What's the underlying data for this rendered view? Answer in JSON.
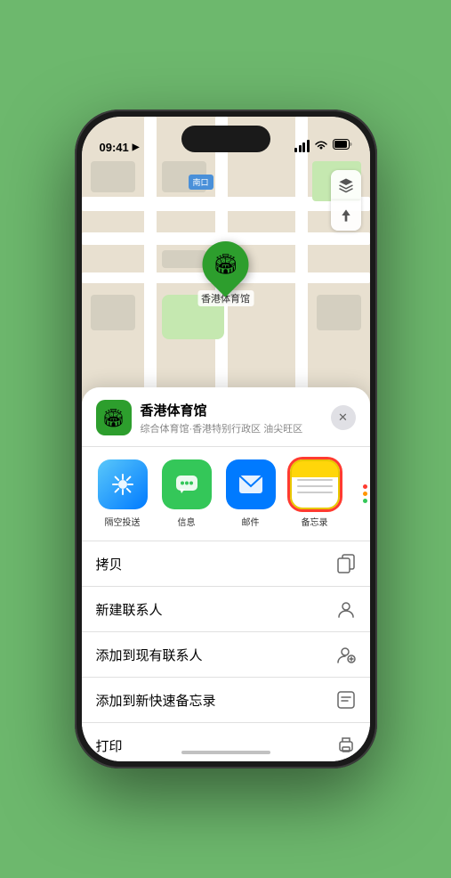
{
  "status": {
    "time": "09:41",
    "location_icon": "▶"
  },
  "map": {
    "label": "南口",
    "layer_icon": "🗺",
    "location_icon": "⤢"
  },
  "pin": {
    "label": "香港体育馆",
    "icon": "🏟"
  },
  "venue": {
    "name": "香港体育馆",
    "subtitle": "综合体育馆·香港特别行政区 油尖旺区",
    "icon": "🏟",
    "close_label": "✕"
  },
  "share_items": [
    {
      "id": "airdrop",
      "label": "隔空投送",
      "icon": "📡",
      "type": "airdrop"
    },
    {
      "id": "messages",
      "label": "信息",
      "icon": "💬",
      "type": "messages"
    },
    {
      "id": "mail",
      "label": "邮件",
      "icon": "✉️",
      "type": "mail"
    },
    {
      "id": "notes",
      "label": "备忘录",
      "icon": "",
      "type": "notes"
    }
  ],
  "actions": [
    {
      "id": "copy",
      "label": "拷贝",
      "icon": "⎘"
    },
    {
      "id": "new-contact",
      "label": "新建联系人",
      "icon": "👤"
    },
    {
      "id": "add-contact",
      "label": "添加到现有联系人",
      "icon": "👤"
    },
    {
      "id": "quick-note",
      "label": "添加到新快速备忘录",
      "icon": "⊡"
    },
    {
      "id": "print",
      "label": "打印",
      "icon": "🖨"
    }
  ]
}
